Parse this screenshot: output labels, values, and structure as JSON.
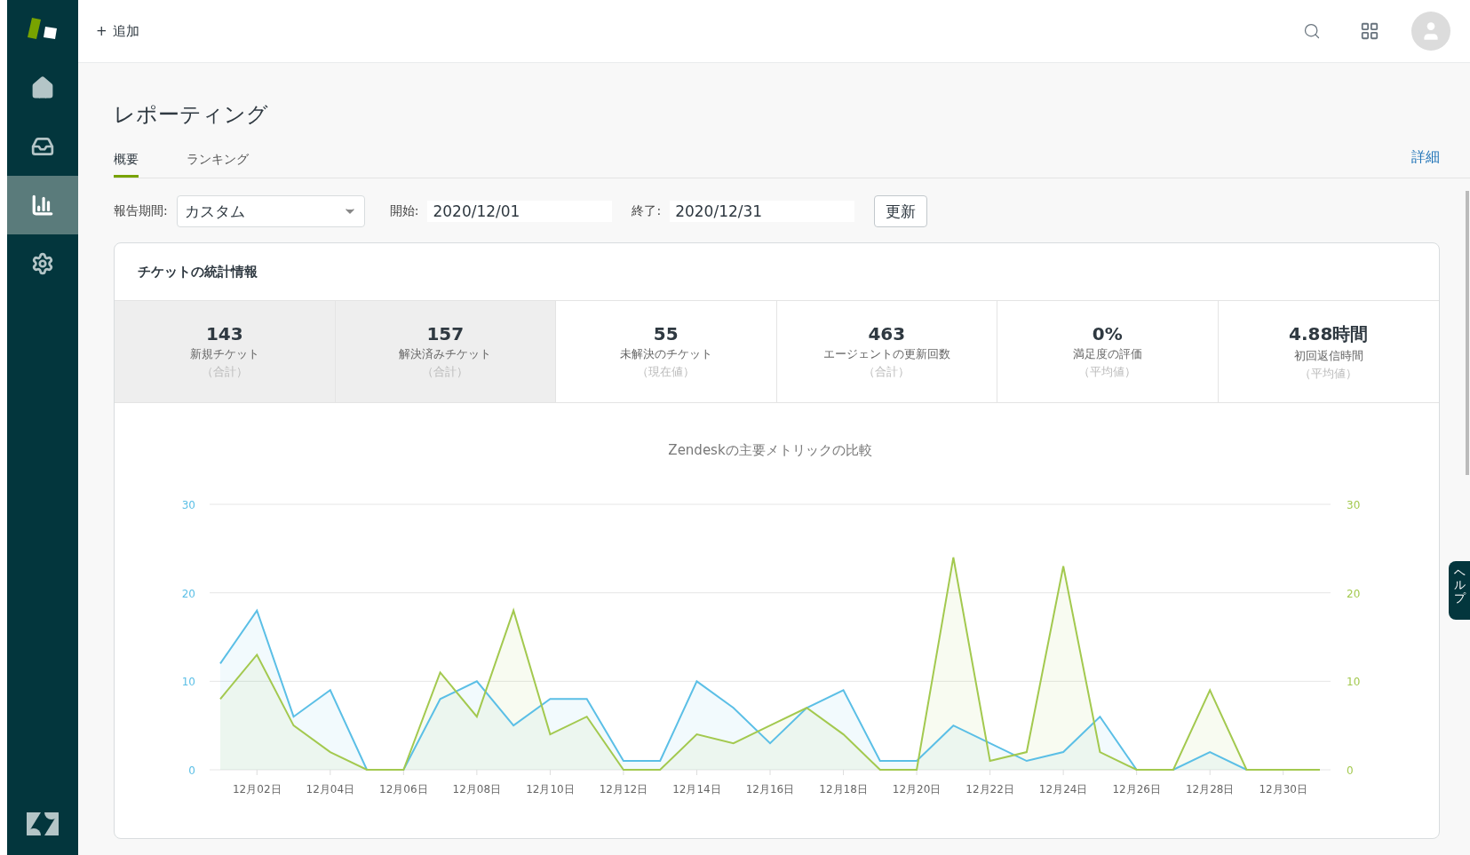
{
  "sidebar": {
    "items": [
      {
        "kind": "home",
        "selected": false
      },
      {
        "kind": "views",
        "selected": false
      },
      {
        "kind": "reporting",
        "selected": true
      },
      {
        "kind": "settings",
        "selected": false
      }
    ]
  },
  "topbar": {
    "add_button": {
      "icon": "+",
      "label": "追加"
    }
  },
  "page": {
    "title": "レポーティング",
    "tabs": [
      {
        "label": "概要",
        "selected": true
      },
      {
        "label": "ランキング",
        "selected": false
      }
    ],
    "details_link": "詳細"
  },
  "filters": {
    "period_label": "報告期間:",
    "period_value": "カスタム",
    "start_label": "開始:",
    "start_value": "2020/12/01",
    "end_label": "終了:",
    "end_value": "2020/12/31",
    "update_button": "更新"
  },
  "stats_card": {
    "title": "チケットの統計情報",
    "metrics": [
      {
        "value": "143",
        "label": "新規チケット",
        "note": "（合計）",
        "selected": true
      },
      {
        "value": "157",
        "label": "解決済みチケット",
        "note": "（合計）",
        "selected": true
      },
      {
        "value": "55",
        "label": "未解決のチケット",
        "note": "（現在値）",
        "selected": false
      },
      {
        "value": "463",
        "label": "エージェントの更新回数",
        "note": "（合計）",
        "selected": false
      },
      {
        "value": "0%",
        "label": "満足度の評価",
        "note": "（平均値）",
        "selected": false
      },
      {
        "value": "4.88時間",
        "label": "初回返信時間",
        "note": "（平均値）",
        "selected": false
      }
    ],
    "chart_data": {
      "type": "area",
      "title": "Zendeskの主要メトリックの比較",
      "categories": [
        null,
        "12月02日",
        null,
        "12月04日",
        null,
        "12月06日",
        null,
        "12月08日",
        null,
        "12月10日",
        null,
        "12月12日",
        null,
        "12月14日",
        null,
        "12月16日",
        null,
        "12月18日",
        null,
        "12月20日",
        null,
        "12月22日",
        null,
        "12月24日",
        null,
        "12月26日",
        null,
        "12月28日",
        null,
        "12月30日",
        null
      ],
      "series": [
        {
          "color": "#5bbfe6",
          "values": [
            12,
            18,
            6,
            9,
            0,
            0,
            8,
            10,
            5,
            8,
            8,
            1,
            1,
            10,
            7,
            3,
            7,
            9,
            1,
            1,
            5,
            3,
            1,
            2,
            6,
            0,
            0,
            2,
            0,
            0,
            0
          ]
        },
        {
          "color": "#a3c94f",
          "values": [
            8,
            13,
            5,
            2,
            0,
            0,
            11,
            6,
            18,
            4,
            6,
            0,
            0,
            4,
            3,
            5,
            7,
            4,
            0,
            0,
            24,
            1,
            2,
            23,
            2,
            0,
            0,
            9,
            0,
            0,
            0
          ]
        }
      ],
      "ylim": [
        0,
        30
      ],
      "yticks": [
        0,
        10,
        20,
        30
      ],
      "y2lim": [
        0,
        30
      ],
      "y2ticks": [
        0,
        10,
        20,
        30
      ]
    }
  },
  "help_tab": "ヘルプ"
}
